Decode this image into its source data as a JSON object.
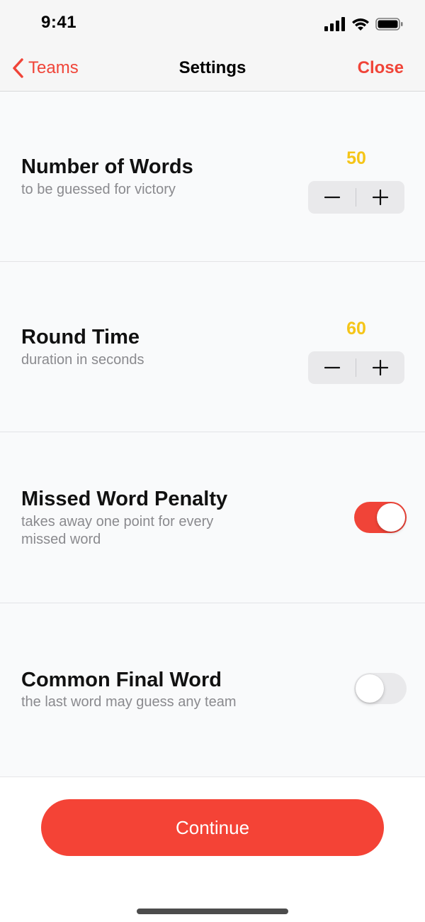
{
  "status_bar": {
    "time": "9:41",
    "icons": [
      "signal-icon",
      "wifi-icon",
      "battery-icon"
    ]
  },
  "nav": {
    "back_label": "Teams",
    "title": "Settings",
    "close_label": "Close"
  },
  "settings": [
    {
      "title": "Number of Words",
      "subtitle": "to be guessed for victory",
      "control": "stepper",
      "value": "50"
    },
    {
      "title": "Round Time",
      "subtitle": "duration in seconds",
      "control": "stepper",
      "value": "60"
    },
    {
      "title": "Missed Word Penalty",
      "subtitle": "takes away one point for every missed word",
      "control": "toggle",
      "on": true
    },
    {
      "title": "Common Final Word",
      "subtitle": "the last word may guess any team",
      "control": "toggle",
      "on": false
    }
  ],
  "continue_label": "Continue",
  "colors": {
    "accent": "#f04438",
    "button": "#f44336",
    "value": "#f5c518",
    "toggle_on": "#f04438",
    "toggle_off": "#e9e9eb"
  }
}
